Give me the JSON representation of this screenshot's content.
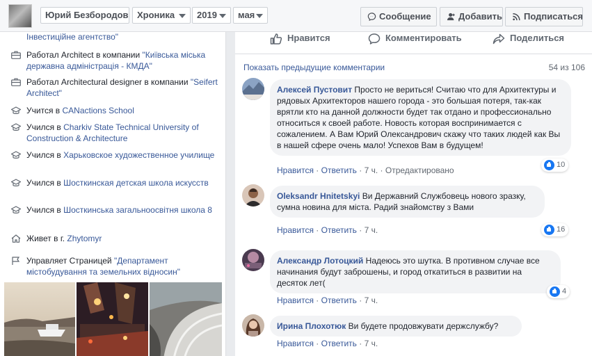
{
  "topbar": {
    "name": "Юрий Безбородов",
    "chronicle": "Хроника",
    "year": "2019",
    "month": "мая",
    "message_label": "Сообщение",
    "add_label": "Добавить",
    "subscribe_label": "Подписаться"
  },
  "about": [
    {
      "icon": "briefcase-icon",
      "prefix": "",
      "link": "Інвестиційне агентство\"",
      "suffix": ""
    },
    {
      "icon": "briefcase-icon",
      "prefix": "Работал Architect в компании ",
      "link": "\"Київська міська державна адміністрація - КМДА\"",
      "suffix": ""
    },
    {
      "icon": "briefcase-icon",
      "prefix": "Работал Architectural designer в компании ",
      "link": "\"Seifert Architect\"",
      "suffix": ""
    },
    {
      "icon": "graduation-cap-icon",
      "prefix": "Учится в ",
      "link": "CANactions School",
      "suffix": ""
    },
    {
      "icon": "graduation-cap-icon",
      "prefix": "Учился в ",
      "link": "Charkiv State Technical University of Construction & Architecture",
      "suffix": ""
    },
    {
      "icon": "graduation-cap-icon",
      "prefix": "Учился в ",
      "link": "Харьковское художественное училище",
      "suffix": ""
    },
    {
      "icon": "graduation-cap-icon",
      "prefix": "Учился в ",
      "link": "Шосткинская детская школа искусств",
      "suffix": ""
    },
    {
      "icon": "graduation-cap-icon",
      "prefix": "Учился в ",
      "link": "Шосткинська загальноосвітня школа 8",
      "suffix": ""
    },
    {
      "icon": "home-icon",
      "prefix": "Живет в г. ",
      "link": "Zhytomyr",
      "suffix": ""
    },
    {
      "icon": "flag-icon",
      "prefix": "Управляет Страницей ",
      "link": "\"Департамент містобудування та земельних відносин\"",
      "suffix": ""
    }
  ],
  "post_actions": {
    "like": "Нравится",
    "comment": "Комментировать",
    "share": "Поделиться"
  },
  "comments_header": {
    "show_previous": "Показать предыдущие комментарии",
    "count": "54 из 106"
  },
  "comments": [
    {
      "author": "Алексей Пустовит",
      "text": "Просто не вериться! Считаю что для Архитектуры и рядовых Архитекторов нашего города - это большая потеря, так-как врятли кто на данной должности будет так отдано и профессионально относиться к своей работе. Новость которая воспринимается с сожалением. А Вам Юрий Олександрович скажу что таких людей как Вы в нашей сфере очень мало! Успехов Вам в будущем!",
      "like": "Нравится",
      "reply": "Ответить",
      "time": "7 ч.",
      "extra": "Отредактировано",
      "reactions": "10"
    },
    {
      "author": "Oleksandr Hnitetskyi",
      "text": "Ви Державний Службовець нового зразку, сумна новина для міста. Радий знайомству з Вами",
      "like": "Нравится",
      "reply": "Ответить",
      "time": "7 ч.",
      "extra": "",
      "reactions": "16"
    },
    {
      "author": "Александр Лотоцкий",
      "text": "Надеюсь это шутка. В противном случае все начинания будут заброшены, и город откатиться в развитии на десяток лет(",
      "like": "Нравится",
      "reply": "Ответить",
      "time": "7 ч.",
      "extra": "",
      "reactions": "4"
    },
    {
      "author": "Ирина Плохотюк",
      "text": "Ви будете продовжувати держслужбу?",
      "like": "Нравится",
      "reply": "Ответить",
      "time": "7 ч.",
      "extra": "",
      "reactions": ""
    }
  ],
  "colors": {
    "link": "#385898",
    "muted": "#606770",
    "bubble": "#f2f3f5",
    "like_blue": "#1877f2"
  }
}
